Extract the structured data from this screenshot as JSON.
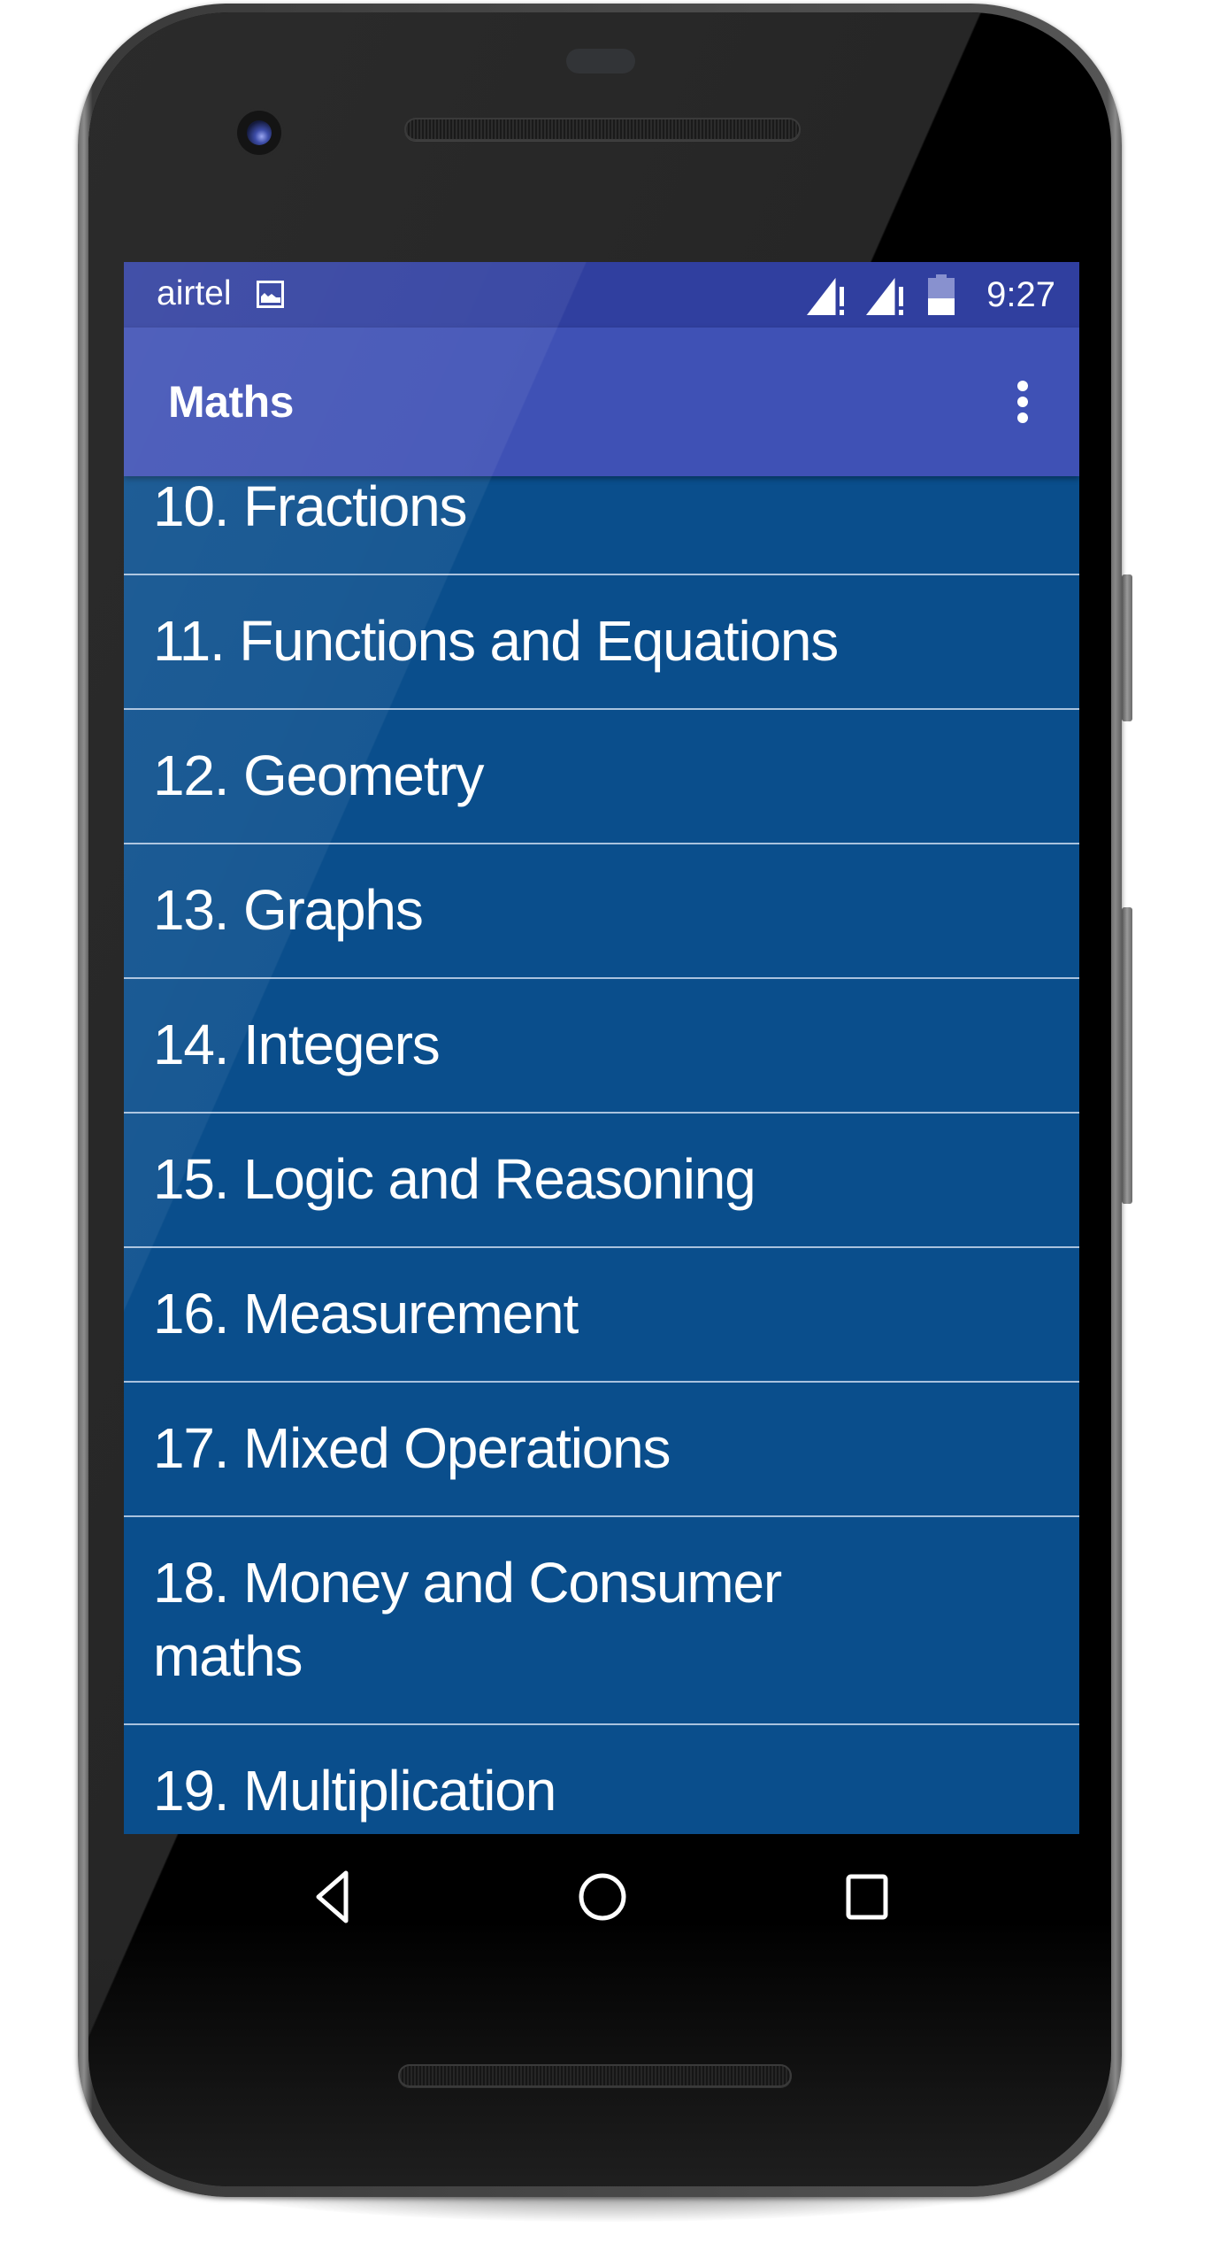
{
  "status_bar": {
    "carrier": "airtel",
    "notification_icon": "gallery-image-icon",
    "signal_icons": [
      "signal-no-data-icon",
      "signal-no-data-icon"
    ],
    "battery_icon": "battery-half-icon",
    "battery_level_fraction": 0.45,
    "time": "9:27"
  },
  "app_bar": {
    "title": "Maths",
    "overflow_icon": "more-vert-icon"
  },
  "topics": [
    {
      "label": "10. Fractions"
    },
    {
      "label": "11. Functions and Equations"
    },
    {
      "label": "12. Geometry"
    },
    {
      "label": "13. Graphs"
    },
    {
      "label": "14. Integers"
    },
    {
      "label": "15. Logic and Reasoning"
    },
    {
      "label": "16. Measurement"
    },
    {
      "label": "17. Mixed Operations"
    },
    {
      "label": "18. Money and Consumer maths"
    },
    {
      "label": "19. Multiplication"
    }
  ],
  "nav_bar": {
    "back_icon": "back-triangle-icon",
    "home_icon": "home-circle-icon",
    "recents_icon": "recents-square-icon"
  },
  "colors": {
    "status_bar": "#303f9f",
    "app_bar": "#3f51b5",
    "list_background": "#0a4e8c",
    "divider": "#a9c2de",
    "text": "#ffffff"
  }
}
